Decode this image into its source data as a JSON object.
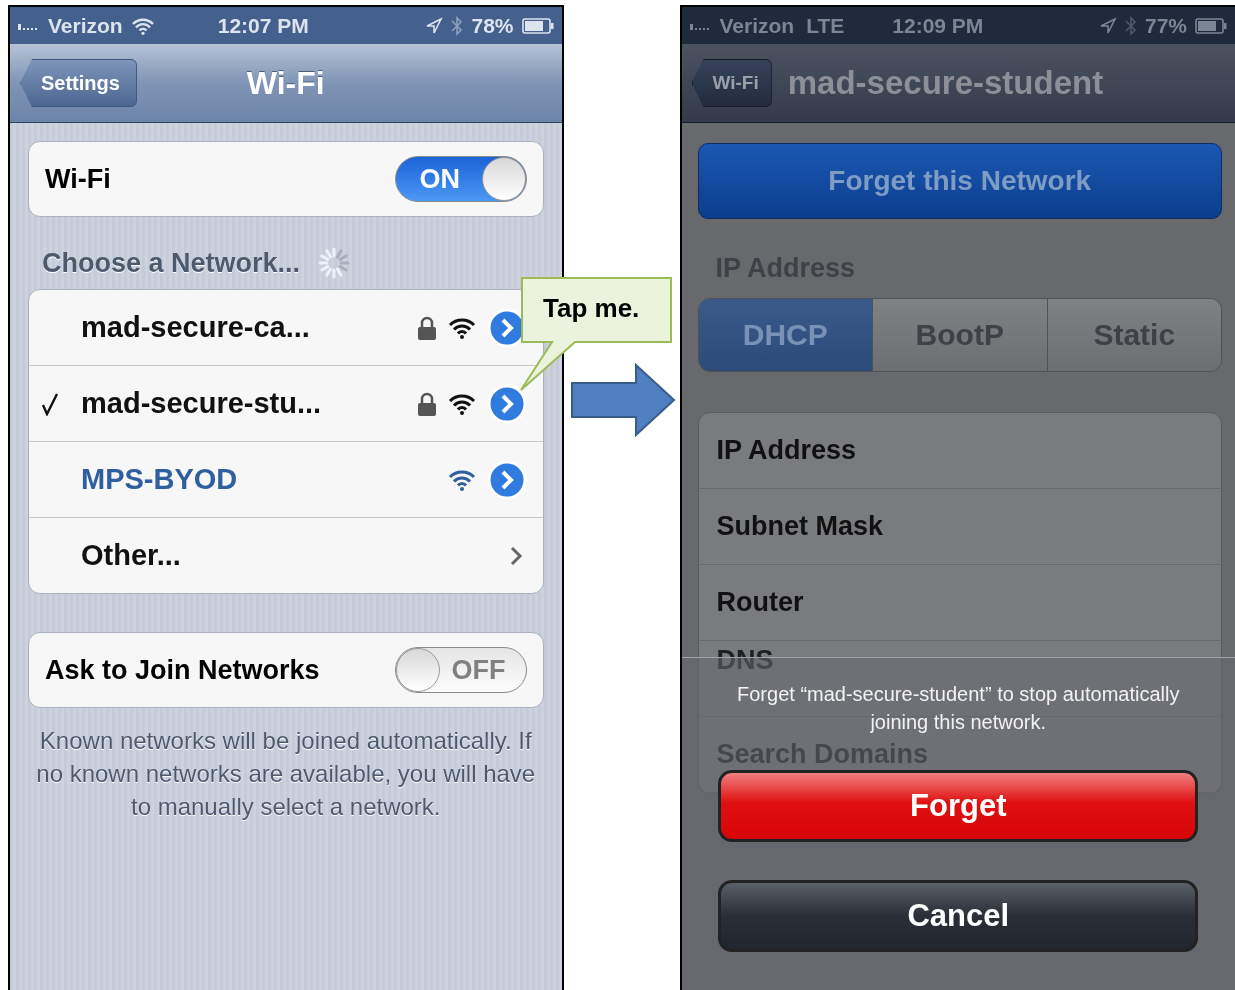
{
  "left_screen": {
    "status_bar": {
      "carrier": "Verizon",
      "time": "12:07 PM",
      "battery": "78%"
    },
    "nav": {
      "back": "Settings",
      "title": "Wi-Fi"
    },
    "wifi_switch": {
      "label": "Wi-Fi",
      "on": true,
      "state_text": "ON"
    },
    "section_title": "Choose a Network...",
    "networks": [
      {
        "kind": "network",
        "name": "mad-secure-ca...",
        "selected": false,
        "locked": true,
        "highlighted": false
      },
      {
        "kind": "network",
        "name": "mad-secure-stu...",
        "selected": true,
        "locked": true,
        "highlighted": false
      },
      {
        "kind": "network",
        "name": "MPS-BYOD",
        "selected": false,
        "locked": false,
        "highlighted": true
      },
      {
        "kind": "other",
        "name": "Other...",
        "selected": false,
        "locked": false,
        "highlighted": false
      }
    ],
    "ask_switch": {
      "label": "Ask to Join Networks",
      "on": false,
      "state_text": "OFF"
    },
    "footer": "Known networks will be joined automatically. If no known networks are available, you will have to manually select a network."
  },
  "callout": {
    "text": "Tap me."
  },
  "right_screen": {
    "status_bar": {
      "carrier": "Verizon",
      "network": "LTE",
      "time": "12:09 PM",
      "battery": "77%"
    },
    "nav": {
      "back": "Wi-Fi",
      "title": "mad-secure-student"
    },
    "forget_button": "Forget this Network",
    "section_title": "IP Address",
    "segments": [
      {
        "label": "DHCP",
        "selected": true
      },
      {
        "label": "BootP",
        "selected": false
      },
      {
        "label": "Static",
        "selected": false
      }
    ],
    "fields": [
      "IP Address",
      "Subnet Mask",
      "Router",
      "DNS",
      "Search Domains"
    ],
    "action_sheet": {
      "message": "Forget “mad-secure-student” to stop automatically joining this network.",
      "confirm": "Forget",
      "cancel": "Cancel"
    }
  }
}
